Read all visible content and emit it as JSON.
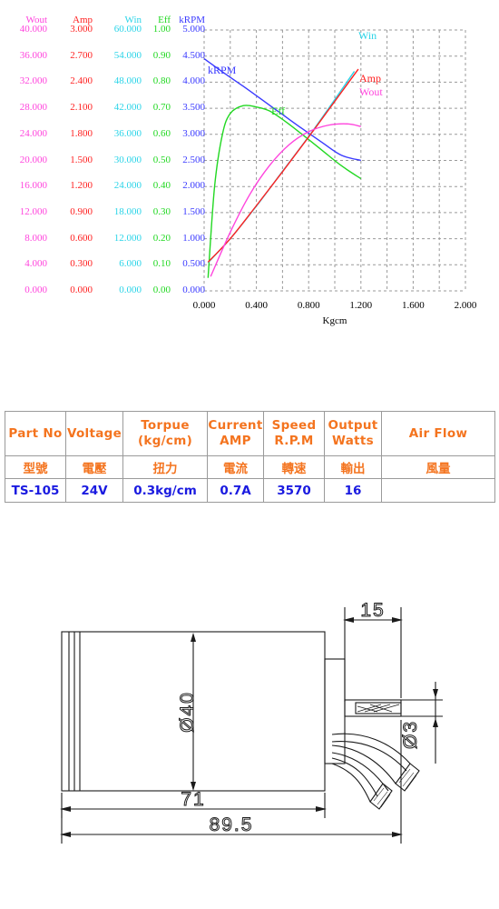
{
  "chart": {
    "xaxis_title": "Kgcm",
    "x_ticks": [
      "0.000",
      "0.400",
      "0.800",
      "1.200",
      "1.600",
      "2.000"
    ],
    "columns": [
      {
        "name": "Wout",
        "color": "#ff44dd",
        "ticks": [
          "40.000",
          "36.000",
          "32.000",
          "28.000",
          "24.000",
          "20.000",
          "16.000",
          "12.000",
          "8.000",
          "4.000",
          "0.000"
        ]
      },
      {
        "name": "Amp",
        "color": "#ff2020",
        "ticks": [
          "3.000",
          "2.700",
          "2.400",
          "2.100",
          "1.800",
          "1.500",
          "1.200",
          "0.900",
          "0.600",
          "0.300",
          "0.000"
        ]
      },
      {
        "name": "Win",
        "color": "#2ad4e8",
        "ticks": [
          "60.000",
          "54.000",
          "48.000",
          "42.000",
          "36.000",
          "30.000",
          "24.000",
          "18.000",
          "12.000",
          "6.000",
          "0.000"
        ]
      },
      {
        "name": "Eff",
        "color": "#22d822",
        "ticks": [
          "1.00",
          "0.90",
          "0.80",
          "0.70",
          "0.60",
          "0.50",
          "0.40",
          "0.30",
          "0.20",
          "0.10",
          "0.00"
        ]
      },
      {
        "name": "kRPM",
        "color": "#3a3aff",
        "ticks": [
          "5.000",
          "4.500",
          "4.000",
          "3.500",
          "3.000",
          "2.500",
          "2.000",
          "1.500",
          "1.000",
          "0.500",
          "0.000"
        ]
      }
    ],
    "series_labels": [
      {
        "name": "Win",
        "color": "#2ad4e8"
      },
      {
        "name": "kRPM",
        "color": "#3a3aff"
      },
      {
        "name": "Amp",
        "color": "#ff2020"
      },
      {
        "name": "Wout",
        "color": "#ff44dd"
      },
      {
        "name": "Eff",
        "color": "#22d822"
      }
    ]
  },
  "chart_data": {
    "type": "line",
    "title": "",
    "xlabel": "Kgcm",
    "ylabel": "",
    "xlim": [
      0.0,
      2.0
    ],
    "grid": true,
    "legend": "inline-at-curve-end",
    "x_ticks": [
      0.0,
      0.4,
      0.8,
      1.2,
      1.6,
      2.0
    ],
    "axes": [
      {
        "name": "Wout",
        "unit": "W",
        "color": "#ff44dd",
        "range": [
          0,
          40
        ],
        "ticks": [
          0,
          4,
          8,
          12,
          16,
          20,
          24,
          28,
          32,
          36,
          40
        ]
      },
      {
        "name": "Amp",
        "unit": "A",
        "color": "#ff2020",
        "range": [
          0,
          3
        ],
        "ticks": [
          0,
          0.3,
          0.6,
          0.9,
          1.2,
          1.5,
          1.8,
          2.1,
          2.4,
          2.7,
          3.0
        ]
      },
      {
        "name": "Win",
        "unit": "W",
        "color": "#2ad4e8",
        "range": [
          0,
          60
        ],
        "ticks": [
          0,
          6,
          12,
          18,
          24,
          30,
          36,
          42,
          48,
          54,
          60
        ]
      },
      {
        "name": "Eff",
        "unit": "",
        "color": "#22d822",
        "range": [
          0,
          1
        ],
        "ticks": [
          0,
          0.1,
          0.2,
          0.3,
          0.4,
          0.5,
          0.6,
          0.7,
          0.8,
          0.9,
          1.0
        ]
      },
      {
        "name": "kRPM",
        "unit": "kRPM",
        "color": "#3a3aff",
        "range": [
          0,
          5
        ],
        "ticks": [
          0,
          0.5,
          1.0,
          1.5,
          2.0,
          2.5,
          3.0,
          3.5,
          4.0,
          4.5,
          5.0
        ]
      }
    ],
    "series": [
      {
        "name": "kRPM",
        "color": "#3a3aff",
        "axis": "kRPM",
        "x": [
          0.0,
          0.15,
          0.3,
          0.45,
          0.6,
          0.75,
          0.9,
          1.05,
          1.2
        ],
        "values": [
          4.45,
          4.18,
          3.92,
          3.65,
          3.38,
          3.11,
          2.85,
          2.6,
          2.5
        ]
      },
      {
        "name": "Eff",
        "color": "#22d822",
        "axis": "Eff",
        "x": [
          0.03,
          0.08,
          0.14,
          0.2,
          0.3,
          0.4,
          0.5,
          0.62,
          0.75,
          0.9,
          1.05,
          1.2
        ],
        "values": [
          0.05,
          0.4,
          0.6,
          0.68,
          0.71,
          0.705,
          0.69,
          0.65,
          0.6,
          0.54,
          0.48,
          0.43
        ]
      },
      {
        "name": "Win",
        "color": "#2ad4e8",
        "axis": "Win",
        "x": [
          0.03,
          0.2,
          0.4,
          0.6,
          0.8,
          1.0,
          1.15
        ],
        "values": [
          6.5,
          12.0,
          19.5,
          27.5,
          35.5,
          44.0,
          50.5
        ]
      },
      {
        "name": "Amp",
        "color": "#ff2020",
        "axis": "Amp",
        "x": [
          0.03,
          0.2,
          0.4,
          0.6,
          0.8,
          1.0,
          1.18
        ],
        "values": [
          0.33,
          0.6,
          0.98,
          1.37,
          1.77,
          2.18,
          2.55
        ]
      },
      {
        "name": "Wout",
        "color": "#ff44dd",
        "axis": "Wout",
        "x": [
          0.05,
          0.2,
          0.35,
          0.5,
          0.65,
          0.8,
          0.95,
          1.1,
          1.2
        ],
        "values": [
          2.2,
          9.0,
          14.8,
          19.2,
          22.4,
          24.4,
          25.4,
          25.6,
          25.2
        ]
      }
    ]
  },
  "spec_table": {
    "headers_en": [
      {
        "line1": "Part No",
        "line2": ""
      },
      {
        "line1": "Voltage",
        "line2": ""
      },
      {
        "line1": "Torpue",
        "line2": "(kg/cm)"
      },
      {
        "line1": "Current",
        "line2": "AMP"
      },
      {
        "line1": "Speed",
        "line2": "R.P.M"
      },
      {
        "line1": "Output",
        "line2": "Watts"
      },
      {
        "line1": "Air  Flow",
        "line2": ""
      }
    ],
    "headers_cn": [
      "型號",
      "電壓",
      "扭力",
      "電流",
      "轉速",
      "輸出",
      "風量"
    ],
    "values": [
      "TS-105",
      "24V",
      "0.3kg/cm",
      "0.7A",
      "3570",
      "16",
      ""
    ]
  },
  "drawing": {
    "dim_diameter_body": "Ø40",
    "dim_body_length": "71",
    "dim_total_length": "89.5",
    "dim_shaft_length": "15",
    "dim_shaft_diameter": "Ø3"
  }
}
